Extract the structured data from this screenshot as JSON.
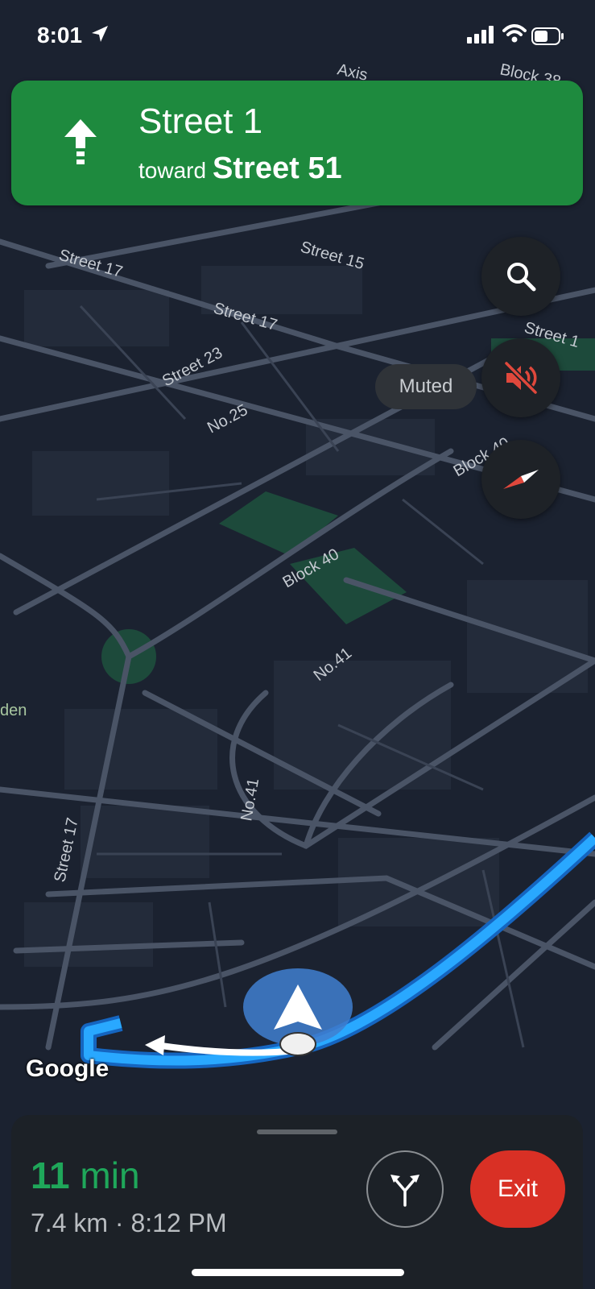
{
  "status_bar": {
    "time": "8:01",
    "icons": [
      "location-arrow-icon",
      "cellular-signal-icon",
      "wifi-icon",
      "battery-icon"
    ]
  },
  "banner": {
    "street": "Street 1",
    "toward_word": "toward",
    "toward_street": "Street 51",
    "maneuver_icon": "straight-arrow-icon",
    "color": "#1e8a3e"
  },
  "map": {
    "labels": [
      "Axis",
      "Block 38",
      "Street 17",
      "Street 15",
      "Street 17",
      "Street 23",
      "No.25",
      "Street 1",
      "Block 40",
      "Block 40",
      "No.41",
      "No.41",
      "Street 17",
      "den"
    ],
    "route_color": "#2196f3",
    "attribution": "Google"
  },
  "controls": {
    "search_icon": "search-icon",
    "mute_icon": "volume-off-icon",
    "compass_icon": "compass-icon",
    "muted_label": "Muted"
  },
  "bottom_sheet": {
    "eta_minutes": "11",
    "eta_unit": "min",
    "trip_info": "7.4 km · 8:12 PM",
    "routes_icon": "alternate-routes-icon",
    "exit_label": "Exit",
    "exit_color": "#d93025"
  }
}
